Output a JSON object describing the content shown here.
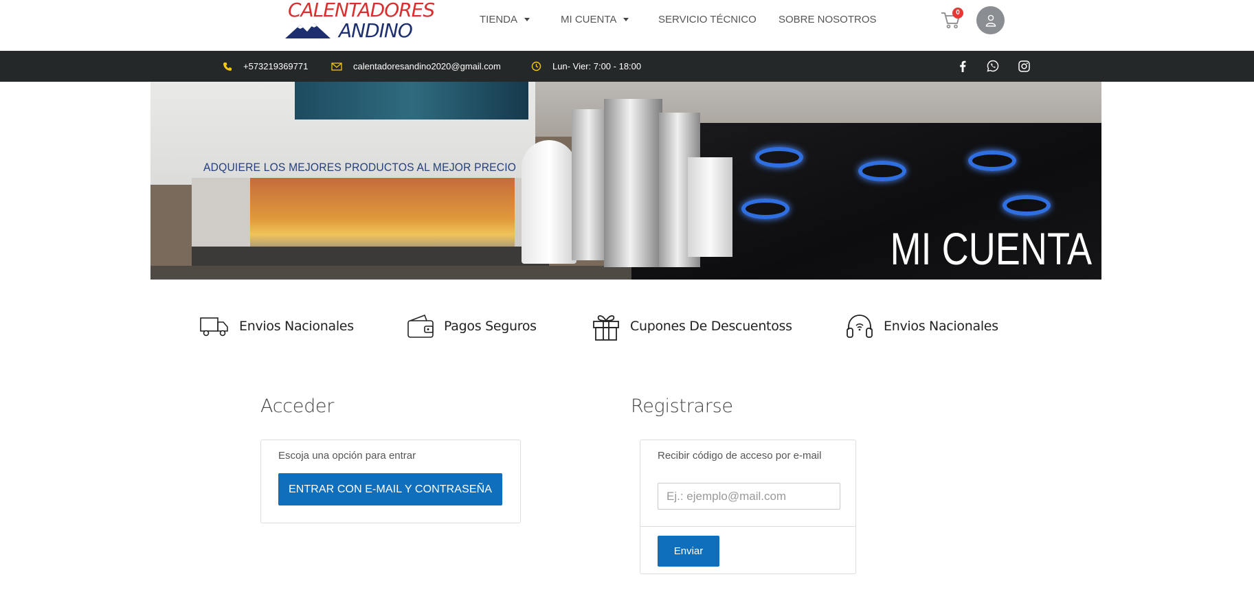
{
  "header": {
    "logo": {
      "top_text": "CALENTADORES",
      "bottom_text": "ANDINO"
    },
    "nav": {
      "tienda": "TIENDA",
      "mi_cuenta": "MI CUENTA",
      "servicio": "SERVICIO TÉCNICO",
      "sobre": "SOBRE NOSOTROS"
    },
    "cart_count": "0",
    "icons": {
      "cart": "cart-icon",
      "user": "user-icon"
    }
  },
  "topbar": {
    "phone": "+573219369771",
    "email": "calentadoresandino2020@gmail.com",
    "hours": "Lun- Vier: 7:00 - 18:00",
    "accent": "#f5c518",
    "social": [
      "facebook-icon",
      "whatsapp-icon",
      "instagram-icon"
    ]
  },
  "banner": {
    "tagline": "ADQUIERE LOS MEJORES PRODUCTOS AL MEJOR PRECIO",
    "title": "MI CUENTA"
  },
  "features": [
    {
      "icon": "truck-icon",
      "label": "Envios Nacionales"
    },
    {
      "icon": "wallet-icon",
      "label": "Pagos Seguros"
    },
    {
      "icon": "gift-icon",
      "label": "Cupones De Descuentoss"
    },
    {
      "icon": "headphones-icon",
      "label": "Envios Nacionales"
    }
  ],
  "login": {
    "title": "Acceder",
    "instruction": "Escoja una opción para entrar",
    "button": "ENTRAR CON E-MAIL Y CONTRASEÑA"
  },
  "register": {
    "title": "Registrarse",
    "instruction": "Recibir código de acceso por e-mail",
    "email_placeholder": "Ej.: ejemplo@mail.com",
    "email_value": "",
    "button": "Enviar"
  },
  "colors": {
    "primary_button": "#0f6fbd",
    "topbar_bg": "#252828",
    "cart_badge": "#e53935"
  }
}
